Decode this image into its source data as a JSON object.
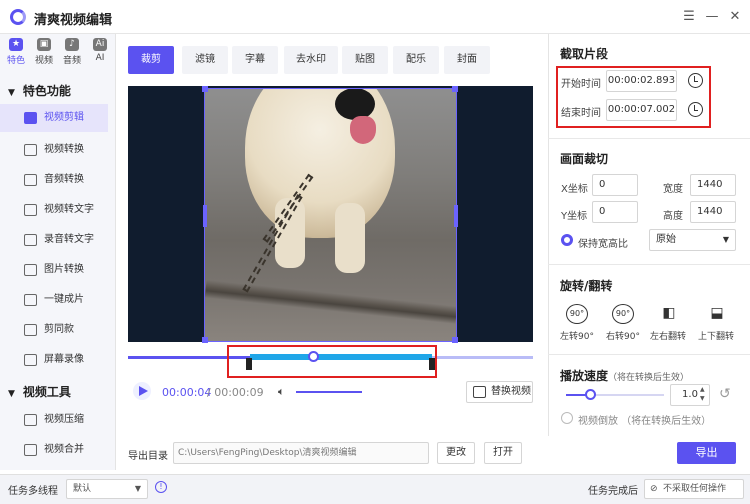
{
  "app": {
    "title": "清爽视频编辑"
  },
  "categories": [
    {
      "label": "特色",
      "icon": "star-icon",
      "active": true
    },
    {
      "label": "视频",
      "icon": "video-icon",
      "active": false
    },
    {
      "label": "音频",
      "icon": "music-icon",
      "active": false
    },
    {
      "label": "AI",
      "icon": "ai-icon",
      "active": false
    }
  ],
  "sidebar": {
    "section1": "特色功能",
    "items1": [
      "视频剪辑",
      "视频转换",
      "音频转换",
      "视频转文字",
      "录音转文字",
      "图片转换",
      "一键成片",
      "剪同款",
      "屏幕录像"
    ],
    "section2": "视频工具",
    "items2": [
      "视频压缩",
      "视频合并"
    ]
  },
  "function_tabs": [
    "裁剪",
    "滤镜",
    "字幕",
    "去水印",
    "贴图",
    "配乐",
    "封面"
  ],
  "player": {
    "current_time": "00:00:04",
    "total_time": "/ 00:00:09",
    "replace_label": "替换视频",
    "played_fraction": 0.46,
    "selection_start_fraction": 0.3,
    "selection_end_fraction": 0.75
  },
  "export": {
    "label": "导出目录",
    "path": "C:\\Users\\FengPing\\Desktop\\清爽视频编辑",
    "change_label": "更改",
    "open_label": "打开",
    "export_label": "导出"
  },
  "clip": {
    "header": "截取片段",
    "start_label": "开始时间",
    "start_value": "00:00:02.893",
    "end_label": "结束时间",
    "end_value": "00:00:07.002"
  },
  "crop": {
    "header": "画面裁切",
    "x_label": "X坐标",
    "x_value": "0",
    "y_label": "Y坐标",
    "y_value": "0",
    "w_label": "宽度",
    "w_value": "1440",
    "h_label": "高度",
    "h_value": "1440",
    "keep_ratio_label": "保持宽高比",
    "ratio_value": "原始"
  },
  "rotate": {
    "header": "旋转/翻转",
    "left_label": "左转90°",
    "right_label": "右转90°",
    "hflip_label": "左右翻转",
    "vflip_label": "上下翻转",
    "deg_text": "90°"
  },
  "speed": {
    "header": "播放速度",
    "note": "（将在转换后生效）",
    "value": "1.0",
    "reverse_label": "视频倒放 （将在转换后生效）",
    "fraction": 0.25
  },
  "bottom": {
    "multithread_label": "任务多线程",
    "multithread_value": "默认",
    "after_label": "任务完成后",
    "after_value": "不采取任何操作"
  },
  "colors": {
    "accent": "#5b52f0",
    "timeline_selection": "#1fa6e8",
    "highlight": "#e02020"
  }
}
